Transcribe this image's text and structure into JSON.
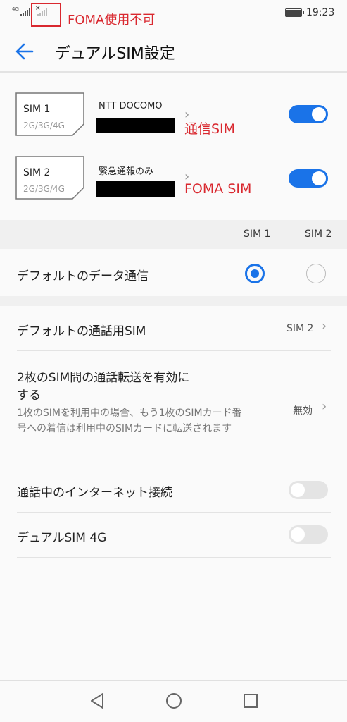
{
  "status_bar": {
    "network_tag": "4G",
    "annotation": "FOMA使用不可",
    "time": "19:23",
    "x_mark": "×"
  },
  "app_bar": {
    "back_icon": "back-arrow-icon",
    "title": "デュアルSIM設定"
  },
  "sims": [
    {
      "card_label": "SIM 1",
      "card_types": "2G/3G/4G",
      "carrier": "NTT DOCOMO",
      "enabled": true,
      "annotation": "通信SIM"
    },
    {
      "card_label": "SIM 2",
      "card_types": "2G/3G/4G",
      "carrier": "緊急通報のみ",
      "enabled": true,
      "annotation": "FOMA SIM"
    }
  ],
  "column_headers": [
    "SIM 1",
    "SIM 2"
  ],
  "default_data": {
    "label": "デフォルトのデータ通信",
    "selected": "SIM 1"
  },
  "default_call": {
    "label": "デフォルトの通話用SIM",
    "value": "SIM 2"
  },
  "call_forward": {
    "label_line1": "2枚のSIM間の通話転送を有効に",
    "label_line2": "する",
    "description": "1枚のSIMを利用中の場合、もう1枚のSIMカード番号への着信は利用中のSIMカードに転送されます",
    "value": "無効"
  },
  "internet_during_call": {
    "label": "通話中のインターネット接続",
    "enabled": false
  },
  "dual_4g": {
    "label": "デュアルSIM 4G",
    "enabled": false
  },
  "colors": {
    "accent": "#1a73e8",
    "annotation_red": "#d9282f"
  },
  "nav_bar": [
    "back-triangle-icon",
    "home-circle-icon",
    "recents-square-icon"
  ]
}
